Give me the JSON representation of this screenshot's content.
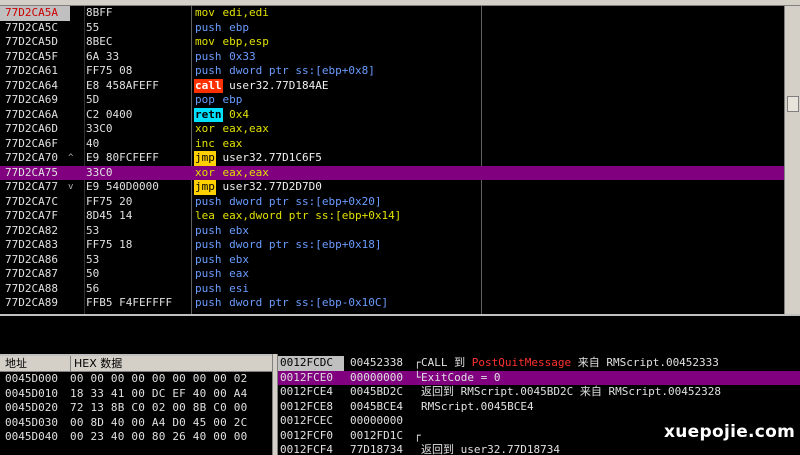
{
  "disasm": [
    {
      "addr": "77D2CA5A",
      "jm": "",
      "hex": "8BFF",
      "mn": "mov",
      "op": "edi,edi",
      "style": "normal",
      "opclass": "op-y",
      "current": true,
      "selected": false
    },
    {
      "addr": "77D2CA5C",
      "jm": "",
      "hex": "55",
      "mn": "push",
      "op": "ebp",
      "style": "push",
      "opclass": "op-b",
      "current": false,
      "selected": false
    },
    {
      "addr": "77D2CA5D",
      "jm": "",
      "hex": "8BEC",
      "mn": "mov",
      "op": "ebp,esp",
      "style": "normal",
      "opclass": "op-y",
      "current": false,
      "selected": false
    },
    {
      "addr": "77D2CA5F",
      "jm": "",
      "hex": "6A 33",
      "mn": "push",
      "op": "0x33",
      "style": "push",
      "opclass": "op-b",
      "current": false,
      "selected": false
    },
    {
      "addr": "77D2CA61",
      "jm": "",
      "hex": "FF75 08",
      "mn": "push",
      "op": "dword ptr ss:[ebp+0x8]",
      "style": "push",
      "opclass": "op-b",
      "current": false,
      "selected": false
    },
    {
      "addr": "77D2CA64",
      "jm": "",
      "hex": "E8 458AFEFF",
      "mn": "call",
      "op": "user32.77D184AE",
      "style": "call",
      "opclass": "op-w",
      "current": false,
      "selected": false
    },
    {
      "addr": "77D2CA69",
      "jm": "",
      "hex": "5D",
      "mn": "pop",
      "op": "ebp",
      "style": "push",
      "opclass": "op-b",
      "current": false,
      "selected": false
    },
    {
      "addr": "77D2CA6A",
      "jm": "",
      "hex": "C2 0400",
      "mn": "retn",
      "op": "0x4",
      "style": "retn",
      "opclass": "op-y",
      "current": false,
      "selected": false
    },
    {
      "addr": "77D2CA6D",
      "jm": "",
      "hex": "33C0",
      "mn": "xor",
      "op": "eax,eax",
      "style": "normal",
      "opclass": "op-y",
      "current": false,
      "selected": false
    },
    {
      "addr": "77D2CA6F",
      "jm": "",
      "hex": "40",
      "mn": "inc",
      "op": "eax",
      "style": "normal",
      "opclass": "op-y",
      "current": false,
      "selected": false
    },
    {
      "addr": "77D2CA70",
      "jm": "^",
      "hex": "E9 80FCFEFF",
      "mn": "jmp",
      "op": "user32.77D1C6F5",
      "style": "jmp",
      "opclass": "op-w",
      "current": false,
      "selected": false
    },
    {
      "addr": "77D2CA75",
      "jm": "",
      "hex": "33C0",
      "mn": "xor",
      "op": "eax,eax",
      "style": "normal",
      "opclass": "op-y",
      "current": false,
      "selected": true
    },
    {
      "addr": "77D2CA77",
      "jm": "v",
      "hex": "E9 540D0000",
      "mn": "jmp",
      "op": "user32.77D2D7D0",
      "style": "jmp",
      "opclass": "op-w",
      "current": false,
      "selected": false
    },
    {
      "addr": "77D2CA7C",
      "jm": "",
      "hex": "FF75 20",
      "mn": "push",
      "op": "dword ptr ss:[ebp+0x20]",
      "style": "push",
      "opclass": "op-b",
      "current": false,
      "selected": false
    },
    {
      "addr": "77D2CA7F",
      "jm": "",
      "hex": "8D45 14",
      "mn": "lea",
      "op": "eax,dword ptr ss:[ebp+0x14]",
      "style": "normal",
      "opclass": "op-y",
      "current": false,
      "selected": false
    },
    {
      "addr": "77D2CA82",
      "jm": "",
      "hex": "53",
      "mn": "push",
      "op": "ebx",
      "style": "push",
      "opclass": "op-b",
      "current": false,
      "selected": false
    },
    {
      "addr": "77D2CA83",
      "jm": "",
      "hex": "FF75 18",
      "mn": "push",
      "op": "dword ptr ss:[ebp+0x18]",
      "style": "push",
      "opclass": "op-b",
      "current": false,
      "selected": false
    },
    {
      "addr": "77D2CA86",
      "jm": "",
      "hex": "53",
      "mn": "push",
      "op": "ebx",
      "style": "push",
      "opclass": "op-b",
      "current": false,
      "selected": false
    },
    {
      "addr": "77D2CA87",
      "jm": "",
      "hex": "50",
      "mn": "push",
      "op": "eax",
      "style": "push",
      "opclass": "op-b",
      "current": false,
      "selected": false
    },
    {
      "addr": "77D2CA88",
      "jm": "",
      "hex": "56",
      "mn": "push",
      "op": "esi",
      "style": "push",
      "opclass": "op-b",
      "current": false,
      "selected": false
    },
    {
      "addr": "77D2CA89",
      "jm": "",
      "hex": "FFB5 F4FEFFFF",
      "mn": "push",
      "op": "dword ptr ss:[ebp-0x10C]",
      "style": "push",
      "opclass": "op-b",
      "current": false,
      "selected": false
    }
  ],
  "dump": {
    "col_address": "地址",
    "col_hex": "HEX 数据",
    "rows": [
      {
        "addr": "0045D000",
        "bytes": "00 00 00 00 00 00 00 00 02"
      },
      {
        "addr": "0045D010",
        "bytes": "18 33 41 00 DC EF 40 00 A4"
      },
      {
        "addr": "0045D020",
        "bytes": "72 13 8B C0 02 00 8B C0 00"
      },
      {
        "addr": "0045D030",
        "bytes": "00 8D 40 00 A4 D0 45 00 2C"
      },
      {
        "addr": "0045D040",
        "bytes": "00 23 40 00 80 26 40 00 00"
      }
    ]
  },
  "stack": [
    {
      "addr": "0012FCDC",
      "value": "00452338",
      "bracket": "┌",
      "prefix": "CALL 到 ",
      "red": "PostQuitMessage",
      "suffix": " 来自 RMScript.00452333",
      "current": true,
      "selected": false
    },
    {
      "addr": "0012FCE0",
      "value": "00000000",
      "bracket": "└",
      "prefix": "ExitCode = 0",
      "red": "",
      "suffix": "",
      "current": false,
      "selected": true
    },
    {
      "addr": "0012FCE4",
      "value": "0045BD2C",
      "bracket": "",
      "prefix": "返回到 RMScript.0045BD2C 来自 RMScript.00452328",
      "red": "",
      "suffix": "",
      "current": false,
      "selected": false
    },
    {
      "addr": "0012FCE8",
      "value": "0045BCE4",
      "bracket": "",
      "prefix": "RMScript.0045BCE4",
      "red": "",
      "suffix": "",
      "current": false,
      "selected": false
    },
    {
      "addr": "0012FCEC",
      "value": "00000000",
      "bracket": "",
      "prefix": "",
      "red": "",
      "suffix": "",
      "current": false,
      "selected": false
    },
    {
      "addr": "0012FCF0",
      "value": "0012FD1C",
      "bracket": "┌",
      "prefix": "",
      "red": "",
      "suffix": "",
      "current": false,
      "selected": false
    },
    {
      "addr": "0012FCF4",
      "value": "77D18734",
      "bracket": "",
      "prefix": "返回到 user32.77D18734",
      "red": "",
      "suffix": "",
      "current": false,
      "selected": false
    }
  ],
  "watermark": "xuepojie.com",
  "colors": {
    "selection": "#800080",
    "call": "#ff3000",
    "jmp": "#ffd000",
    "retn": "#00e0ff",
    "push": "#6a9cff",
    "mnemonic": "#e0e000"
  }
}
